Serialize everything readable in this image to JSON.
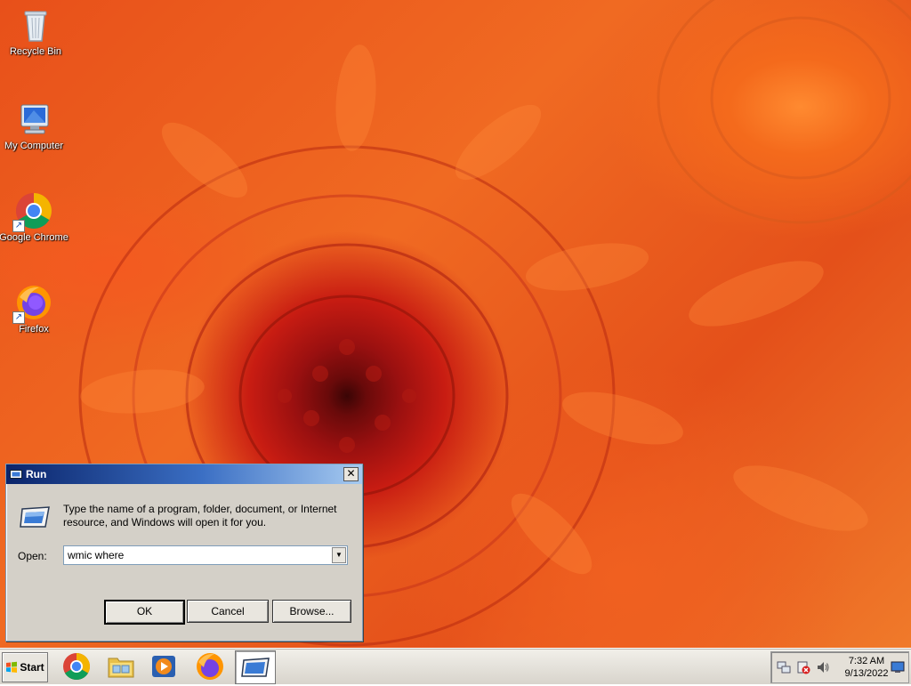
{
  "desktop": {
    "icons": [
      {
        "label": "Recycle Bin",
        "icon": "recycle-bin-icon"
      },
      {
        "label": "My Computer",
        "icon": "my-computer-icon"
      },
      {
        "label": "Google Chrome",
        "icon": "chrome-icon"
      },
      {
        "label": "Firefox",
        "icon": "firefox-icon"
      }
    ]
  },
  "run_dialog": {
    "title": "Run",
    "description": "Type the name of a program, folder, document, or Internet resource, and Windows will open it for you.",
    "open_label": "Open:",
    "input_value": "wmic where",
    "ok_label": "OK",
    "cancel_label": "Cancel",
    "browse_label": "Browse...",
    "close_glyph": "✕"
  },
  "taskbar": {
    "start_label": "Start",
    "pinned": [
      "chrome-icon",
      "file-explorer-icon",
      "media-player-icon",
      "firefox-icon",
      "run-dialog-icon"
    ],
    "clock_time": "7:32 AM",
    "clock_date": "9/13/2022"
  },
  "colors": {
    "title_bar_start": "#0a246a",
    "dialog_face": "#d4d0c8",
    "wallpaper_accent": "#e8501a"
  }
}
